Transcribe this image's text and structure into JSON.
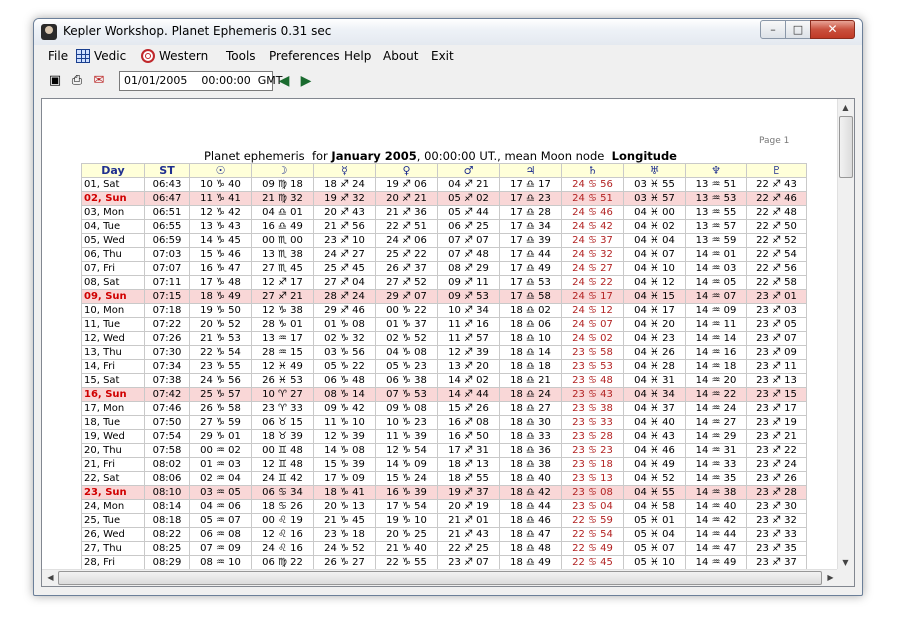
{
  "window": {
    "title": "Kepler Workshop. Planet Ephemeris  0.31 sec",
    "controls": {
      "minimize": "–",
      "maximize": "□",
      "close": "✕"
    }
  },
  "menu": {
    "file": "File",
    "vedic": "Vedic",
    "western": "Western",
    "tools": "Tools",
    "preferences": "Preferences",
    "help": "Help",
    "about": "About",
    "exit": "Exit"
  },
  "toolbar": {
    "datetime": "01/01/2005    00:00:00  GMT",
    "icons": [
      "camera-icon",
      "printer-icon",
      "email-icon",
      "arrow-left-icon",
      "arrow-right-icon"
    ]
  },
  "sheet": {
    "page_label": "Page 1",
    "title_prefix": "Planet ephemeris  for ",
    "title_month": "January 2005",
    "title_middle": ", 00:00:00 UT., mean Moon node  ",
    "title_mode": "Longitude"
  },
  "columns": [
    "Day",
    "ST",
    "☉",
    "☽",
    "☿",
    "♀",
    "♂",
    "♃",
    "♄",
    "♅",
    "♆",
    "♇"
  ],
  "rows": [
    {
      "day": "01,  Sat",
      "sunday": false,
      "cells": [
        "06:43",
        "10 ♑ 40",
        "09 ♍ 18",
        "18 ♐ 24",
        "19 ♐ 06",
        "04 ♐ 21",
        "17 ♎ 17",
        "24 ♋ 56",
        "03 ♓ 55",
        "13 ♒ 51",
        "22 ♐ 43"
      ]
    },
    {
      "day": "02,  Sun",
      "sunday": true,
      "cells": [
        "06:47",
        "11 ♑ 41",
        "21 ♍ 32",
        "19 ♐ 32",
        "20 ♐ 21",
        "05 ♐ 02",
        "17 ♎ 23",
        "24 ♋ 51",
        "03 ♓ 57",
        "13 ♒ 53",
        "22 ♐ 46"
      ]
    },
    {
      "day": "03,  Mon",
      "sunday": false,
      "cells": [
        "06:51",
        "12 ♑ 42",
        "04 ♎ 01",
        "20 ♐ 43",
        "21 ♐ 36",
        "05 ♐ 44",
        "17 ♎ 28",
        "24 ♋ 46",
        "04 ♓ 00",
        "13 ♒ 55",
        "22 ♐ 48"
      ]
    },
    {
      "day": "04,  Tue",
      "sunday": false,
      "cells": [
        "06:55",
        "13 ♑ 43",
        "16 ♎ 49",
        "21 ♐ 56",
        "22 ♐ 51",
        "06 ♐ 25",
        "17 ♎ 34",
        "24 ♋ 42",
        "04 ♓ 02",
        "13 ♒ 57",
        "22 ♐ 50"
      ]
    },
    {
      "day": "05,  Wed",
      "sunday": false,
      "cells": [
        "06:59",
        "14 ♑ 45",
        "00 ♏ 00",
        "23 ♐ 10",
        "24 ♐ 06",
        "07 ♐ 07",
        "17 ♎ 39",
        "24 ♋ 37",
        "04 ♓ 04",
        "13 ♒ 59",
        "22 ♐ 52"
      ]
    },
    {
      "day": "06,  Thu",
      "sunday": false,
      "cells": [
        "07:03",
        "15 ♑ 46",
        "13 ♏ 38",
        "24 ♐ 27",
        "25 ♐ 22",
        "07 ♐ 48",
        "17 ♎ 44",
        "24 ♋ 32",
        "04 ♓ 07",
        "14 ♒ 01",
        "22 ♐ 54"
      ]
    },
    {
      "day": "07,  Fri",
      "sunday": false,
      "cells": [
        "07:07",
        "16 ♑ 47",
        "27 ♏ 45",
        "25 ♐ 45",
        "26 ♐ 37",
        "08 ♐ 29",
        "17 ♎ 49",
        "24 ♋ 27",
        "04 ♓ 10",
        "14 ♒ 03",
        "22 ♐ 56"
      ]
    },
    {
      "day": "08,  Sat",
      "sunday": false,
      "cells": [
        "07:11",
        "17 ♑ 48",
        "12 ♐ 17",
        "27 ♐ 04",
        "27 ♐ 52",
        "09 ♐ 11",
        "17 ♎ 53",
        "24 ♋ 22",
        "04 ♓ 12",
        "14 ♒ 05",
        "22 ♐ 58"
      ]
    },
    {
      "day": "09,  Sun",
      "sunday": true,
      "cells": [
        "07:15",
        "18 ♑ 49",
        "27 ♐ 21",
        "28 ♐ 24",
        "29 ♐ 07",
        "09 ♐ 53",
        "17 ♎ 58",
        "24 ♋ 17",
        "04 ♓ 15",
        "14 ♒ 07",
        "23 ♐ 01"
      ]
    },
    {
      "day": "10,  Mon",
      "sunday": false,
      "cells": [
        "07:18",
        "19 ♑ 50",
        "12 ♑ 38",
        "29 ♐ 46",
        "00 ♑ 22",
        "10 ♐ 34",
        "18 ♎ 02",
        "24 ♋ 12",
        "04 ♓ 17",
        "14 ♒ 09",
        "23 ♐ 03"
      ]
    },
    {
      "day": "11,  Tue",
      "sunday": false,
      "cells": [
        "07:22",
        "20 ♑ 52",
        "28 ♑ 01",
        "01 ♑ 08",
        "01 ♑ 37",
        "11 ♐ 16",
        "18 ♎ 06",
        "24 ♋ 07",
        "04 ♓ 20",
        "14 ♒ 11",
        "23 ♐ 05"
      ]
    },
    {
      "day": "12,  Wed",
      "sunday": false,
      "cells": [
        "07:26",
        "21 ♑ 53",
        "13 ♒ 17",
        "02 ♑ 32",
        "02 ♑ 52",
        "11 ♐ 57",
        "18 ♎ 10",
        "24 ♋ 02",
        "04 ♓ 23",
        "14 ♒ 14",
        "23 ♐ 07"
      ]
    },
    {
      "day": "13,  Thu",
      "sunday": false,
      "cells": [
        "07:30",
        "22 ♑ 54",
        "28 ♒ 15",
        "03 ♑ 56",
        "04 ♑ 08",
        "12 ♐ 39",
        "18 ♎ 14",
        "23 ♋ 58",
        "04 ♓ 26",
        "14 ♒ 16",
        "23 ♐ 09"
      ]
    },
    {
      "day": "14,  Fri",
      "sunday": false,
      "cells": [
        "07:34",
        "23 ♑ 55",
        "12 ♓ 49",
        "05 ♑ 22",
        "05 ♑ 23",
        "13 ♐ 20",
        "18 ♎ 18",
        "23 ♋ 53",
        "04 ♓ 28",
        "14 ♒ 18",
        "23 ♐ 11"
      ]
    },
    {
      "day": "15,  Sat",
      "sunday": false,
      "cells": [
        "07:38",
        "24 ♑ 56",
        "26 ♓ 53",
        "06 ♑ 48",
        "06 ♑ 38",
        "14 ♐ 02",
        "18 ♎ 21",
        "23 ♋ 48",
        "04 ♓ 31",
        "14 ♒ 20",
        "23 ♐ 13"
      ]
    },
    {
      "day": "16,  Sun",
      "sunday": true,
      "cells": [
        "07:42",
        "25 ♑ 57",
        "10 ♈ 27",
        "08 ♑ 14",
        "07 ♑ 53",
        "14 ♐ 44",
        "18 ♎ 24",
        "23 ♋ 43",
        "04 ♓ 34",
        "14 ♒ 22",
        "23 ♐ 15"
      ]
    },
    {
      "day": "17,  Mon",
      "sunday": false,
      "cells": [
        "07:46",
        "26 ♑ 58",
        "23 ♈ 33",
        "09 ♑ 42",
        "09 ♑ 08",
        "15 ♐ 26",
        "18 ♎ 27",
        "23 ♋ 38",
        "04 ♓ 37",
        "14 ♒ 24",
        "23 ♐ 17"
      ]
    },
    {
      "day": "18,  Tue",
      "sunday": false,
      "cells": [
        "07:50",
        "27 ♑ 59",
        "06 ♉ 15",
        "11 ♑ 10",
        "10 ♑ 23",
        "16 ♐ 08",
        "18 ♎ 30",
        "23 ♋ 33",
        "04 ♓ 40",
        "14 ♒ 27",
        "23 ♐ 19"
      ]
    },
    {
      "day": "19,  Wed",
      "sunday": false,
      "cells": [
        "07:54",
        "29 ♑ 01",
        "18 ♉ 39",
        "12 ♑ 39",
        "11 ♑ 39",
        "16 ♐ 50",
        "18 ♎ 33",
        "23 ♋ 28",
        "04 ♓ 43",
        "14 ♒ 29",
        "23 ♐ 21"
      ]
    },
    {
      "day": "20,  Thu",
      "sunday": false,
      "cells": [
        "07:58",
        "00 ♒ 02",
        "00 ♊ 48",
        "14 ♑ 08",
        "12 ♑ 54",
        "17 ♐ 31",
        "18 ♎ 36",
        "23 ♋ 23",
        "04 ♓ 46",
        "14 ♒ 31",
        "23 ♐ 22"
      ]
    },
    {
      "day": "21,  Fri",
      "sunday": false,
      "cells": [
        "08:02",
        "01 ♒ 03",
        "12 ♊ 48",
        "15 ♑ 39",
        "14 ♑ 09",
        "18 ♐ 13",
        "18 ♎ 38",
        "23 ♋ 18",
        "04 ♓ 49",
        "14 ♒ 33",
        "23 ♐ 24"
      ]
    },
    {
      "day": "22,  Sat",
      "sunday": false,
      "cells": [
        "08:06",
        "02 ♒ 04",
        "24 ♊ 42",
        "17 ♑ 09",
        "15 ♑ 24",
        "18 ♐ 55",
        "18 ♎ 40",
        "23 ♋ 13",
        "04 ♓ 52",
        "14 ♒ 35",
        "23 ♐ 26"
      ]
    },
    {
      "day": "23,  Sun",
      "sunday": true,
      "cells": [
        "08:10",
        "03 ♒ 05",
        "06 ♋ 34",
        "18 ♑ 41",
        "16 ♑ 39",
        "19 ♐ 37",
        "18 ♎ 42",
        "23 ♋ 08",
        "04 ♓ 55",
        "14 ♒ 38",
        "23 ♐ 28"
      ]
    },
    {
      "day": "24,  Mon",
      "sunday": false,
      "cells": [
        "08:14",
        "04 ♒ 06",
        "18 ♋ 26",
        "20 ♑ 13",
        "17 ♑ 54",
        "20 ♐ 19",
        "18 ♎ 44",
        "23 ♋ 04",
        "04 ♓ 58",
        "14 ♒ 40",
        "23 ♐ 30"
      ]
    },
    {
      "day": "25,  Tue",
      "sunday": false,
      "cells": [
        "08:18",
        "05 ♒ 07",
        "00 ♌ 19",
        "21 ♑ 45",
        "19 ♑ 10",
        "21 ♐ 01",
        "18 ♎ 46",
        "22 ♋ 59",
        "05 ♓ 01",
        "14 ♒ 42",
        "23 ♐ 32"
      ]
    },
    {
      "day": "26,  Wed",
      "sunday": false,
      "cells": [
        "08:22",
        "06 ♒ 08",
        "12 ♌ 16",
        "23 ♑ 18",
        "20 ♑ 25",
        "21 ♐ 43",
        "18 ♎ 47",
        "22 ♋ 54",
        "05 ♓ 04",
        "14 ♒ 44",
        "23 ♐ 33"
      ]
    },
    {
      "day": "27,  Thu",
      "sunday": false,
      "cells": [
        "08:25",
        "07 ♒ 09",
        "24 ♌ 16",
        "24 ♑ 52",
        "21 ♑ 40",
        "22 ♐ 25",
        "18 ♎ 48",
        "22 ♋ 49",
        "05 ♓ 07",
        "14 ♒ 47",
        "23 ♐ 35"
      ]
    },
    {
      "day": "28,  Fri",
      "sunday": false,
      "cells": [
        "08:29",
        "08 ♒ 10",
        "06 ♍ 22",
        "26 ♑ 27",
        "22 ♑ 55",
        "23 ♐ 07",
        "18 ♎ 49",
        "22 ♋ 45",
        "05 ♓ 10",
        "14 ♒ 49",
        "23 ♐ 37"
      ]
    }
  ]
}
